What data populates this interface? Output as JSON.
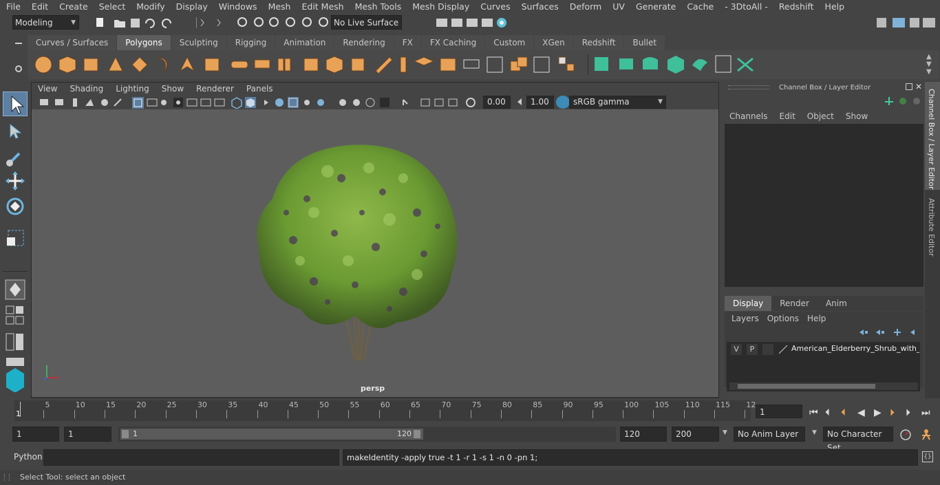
{
  "menus": [
    "File",
    "Edit",
    "Create",
    "Select",
    "Modify",
    "Display",
    "Windows",
    "Mesh",
    "Edit Mesh",
    "Mesh Tools",
    "Mesh Display",
    "Curves",
    "Surfaces",
    "Deform",
    "UV",
    "Generate",
    "Cache",
    "- 3DtoAll -",
    "Redshift",
    "Help"
  ],
  "status": {
    "mode": "Modeling",
    "live_surface": "No Live Surface"
  },
  "shelf_tabs": [
    "Curves / Surfaces",
    "Polygons",
    "Sculpting",
    "Rigging",
    "Animation",
    "Rendering",
    "FX",
    "FX Caching",
    "Custom",
    "XGen",
    "Redshift",
    "Bullet"
  ],
  "shelf_active": "Polygons",
  "viewport": {
    "menus": [
      "View",
      "Shading",
      "Lighting",
      "Show",
      "Renderer",
      "Panels"
    ],
    "exposure": "0.00",
    "gamma": "1.00",
    "color_space": "sRGB gamma",
    "camera_label": "persp"
  },
  "channel_box": {
    "title": "Channel Box / Layer Editor",
    "menus": [
      "Channels",
      "Edit",
      "Object",
      "Show"
    ],
    "layer_tabs": [
      "Display",
      "Render",
      "Anim"
    ],
    "layer_active": "Display",
    "layer_menus": [
      "Layers",
      "Options",
      "Help"
    ],
    "layer": {
      "v": "V",
      "p": "P",
      "name": "American_Elderberry_Shrub_with_Ber"
    }
  },
  "side_tabs": [
    "Channel Box / Layer Editor",
    "Attribute Editor"
  ],
  "timeline": {
    "ticks": [
      "5",
      "10",
      "15",
      "20",
      "25",
      "30",
      "35",
      "40",
      "45",
      "50",
      "55",
      "60",
      "65",
      "70",
      "75",
      "80",
      "85",
      "90",
      "95",
      "100",
      "105",
      "110",
      "115",
      "12"
    ],
    "start_label": "1",
    "current_frame": "1"
  },
  "range": {
    "start": "1",
    "playback_start": "1",
    "slider_start": "1",
    "slider_end": "120",
    "playback_end": "120",
    "end": "200",
    "anim_layer": "No Anim Layer",
    "char_set": "No Character Set"
  },
  "cmdline": {
    "lang": "Python",
    "result": "makeIdentity -apply true -t 1 -r 1 -s 1 -n 0 -pn 1;"
  },
  "help_text": "Select Tool: select an object"
}
